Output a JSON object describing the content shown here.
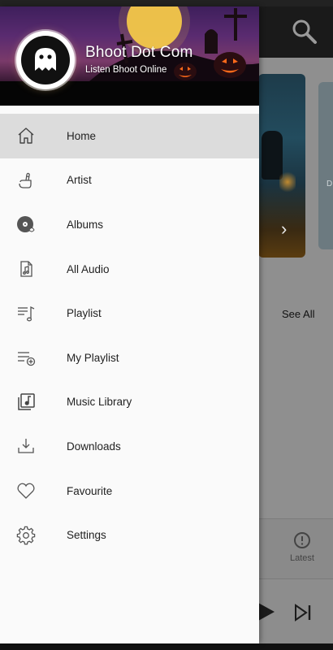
{
  "drawer": {
    "app_name": "Bhoot Dot Com",
    "app_tagline": "Listen Bhoot Online",
    "items": [
      {
        "label": "Home",
        "icon": "home-icon",
        "active": true
      },
      {
        "label": "Artist",
        "icon": "artist-hand-icon",
        "active": false
      },
      {
        "label": "Albums",
        "icon": "album-disc-icon",
        "active": false
      },
      {
        "label": "All Audio",
        "icon": "audio-file-icon",
        "active": false
      },
      {
        "label": "Playlist",
        "icon": "playlist-music-icon",
        "active": false
      },
      {
        "label": "My Playlist",
        "icon": "playlist-add-icon",
        "active": false
      },
      {
        "label": "Music Library",
        "icon": "music-library-icon",
        "active": false
      },
      {
        "label": "Downloads",
        "icon": "download-icon",
        "active": false
      },
      {
        "label": "Favourite",
        "icon": "heart-icon",
        "active": false
      },
      {
        "label": "Settings",
        "icon": "gear-icon",
        "active": false
      }
    ]
  },
  "background": {
    "see_all": "See All",
    "bottom_nav": {
      "latest_label": "Latest"
    }
  },
  "colors": {
    "drawer_bg": "#fafafa",
    "active_item_bg": "#dcdcdc",
    "text": "#222222"
  }
}
